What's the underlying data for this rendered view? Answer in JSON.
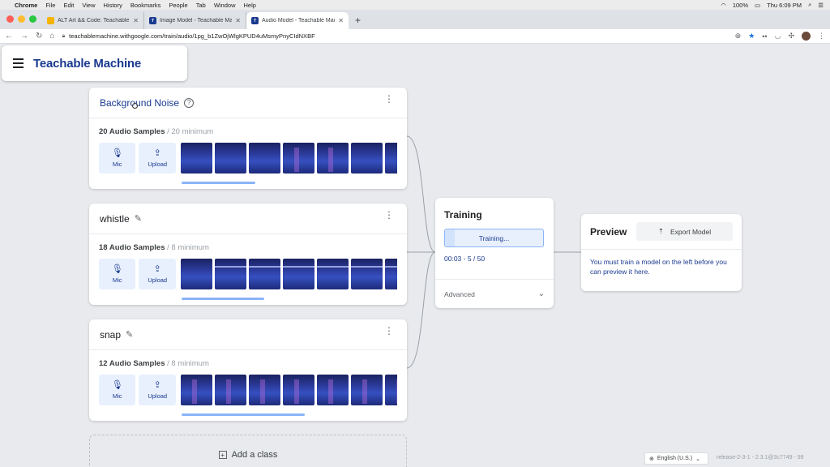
{
  "menubar": {
    "items": [
      "Chrome",
      "File",
      "Edit",
      "View",
      "History",
      "Bookmarks",
      "People",
      "Tab",
      "Window",
      "Help"
    ],
    "battery": "100%",
    "clock": "Thu 6:09 PM"
  },
  "browser": {
    "tabs": [
      {
        "title": "ALT Art && Code: Teachable M",
        "fav_color": "#f4b400"
      },
      {
        "title": "Image Model - Teachable Mac",
        "fav_color": "#1a3a8f"
      },
      {
        "title": "Audio Model - Teachable Mac",
        "fav_color": "#1a3a8f",
        "active": true
      }
    ],
    "url": "teachablemachine.withgoogle.com/train/audio/1pg_b1ZwOjWlgKPUD4uMsmyPnyCIdNXBF"
  },
  "app": {
    "brand": "Teachable Machine",
    "classes": [
      {
        "name": "Background Noise",
        "samples": "20 Audio Samples",
        "minimum": " / 20 minimum",
        "scroll_fraction": 0.33
      },
      {
        "name": "whistle",
        "samples": "18 Audio Samples",
        "minimum": " / 8 minimum",
        "scroll_fraction": 0.37
      },
      {
        "name": "snap",
        "samples": "12 Audio Samples",
        "minimum": " / 8 minimum",
        "scroll_fraction": 0.55
      }
    ],
    "mic_label": "Mic",
    "upload_label": "Upload",
    "add_class": "Add a class",
    "training": {
      "title": "Training",
      "button": "Training...",
      "progress": 0.1,
      "status": "00:03 - 5 / 50",
      "advanced": "Advanced"
    },
    "preview": {
      "title": "Preview",
      "export": "Export Model",
      "message": "You must train a model on the left before you can preview it here."
    },
    "language": "English (U.S.)",
    "release": "release-2-3-1 - 2.3.1@3c7749 - 99"
  }
}
